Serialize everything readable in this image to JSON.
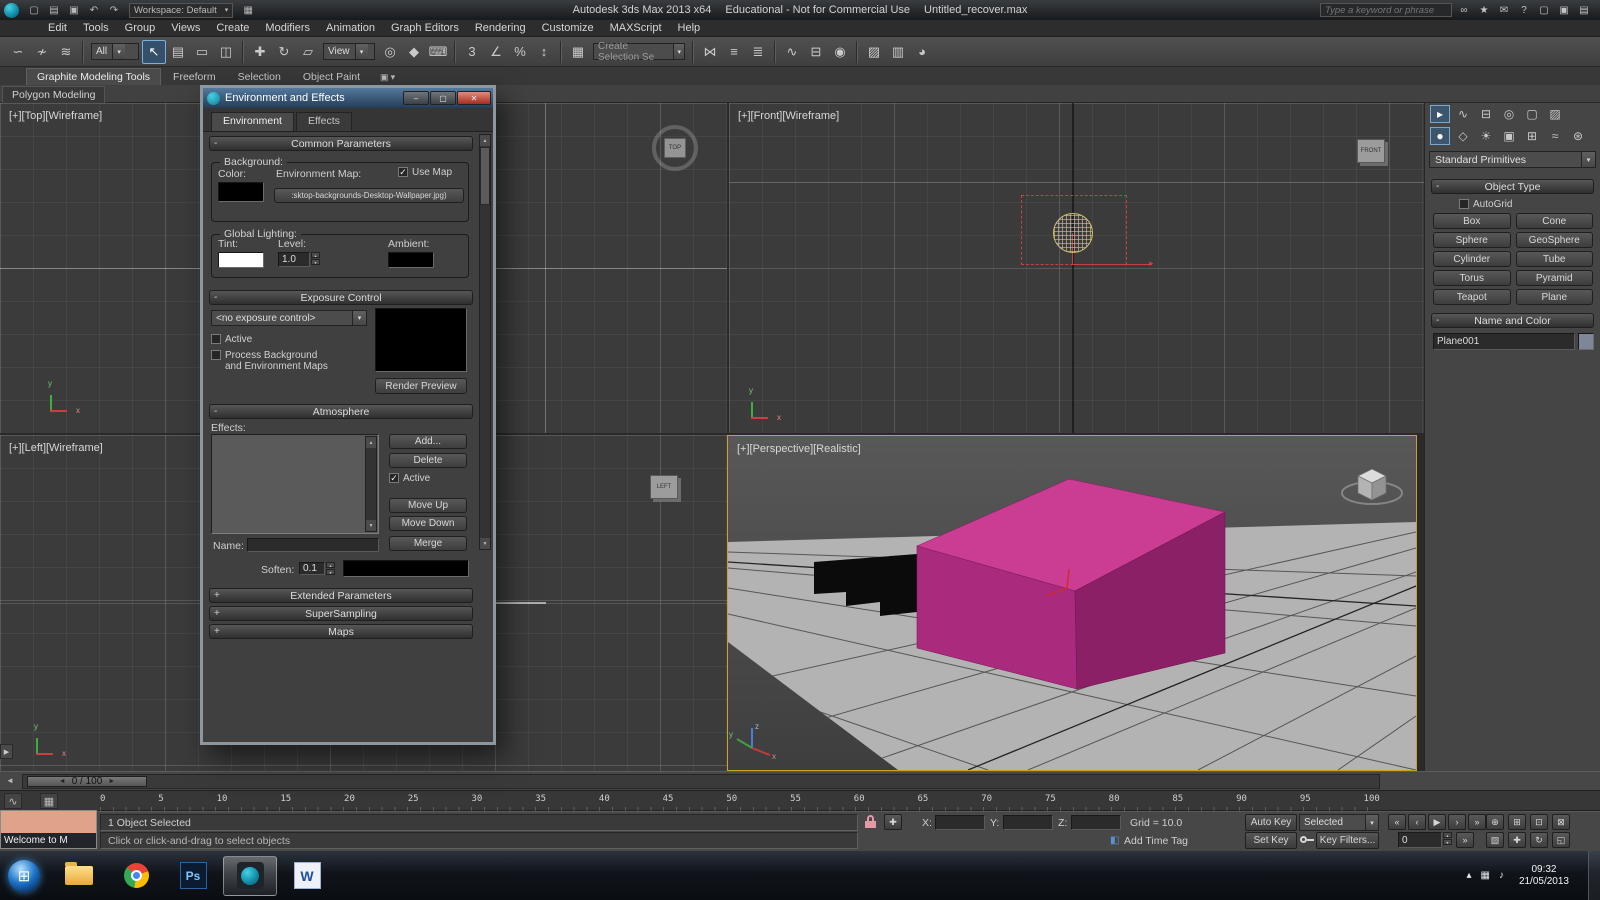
{
  "app": {
    "title_product": "Autodesk 3ds Max  2013 x64",
    "title_license": "Educational - Not for Commercial Use",
    "title_file": "Untitled_recover.max",
    "workspace": "Workspace: Default",
    "search_placeholder": "Type a keyword or phrase"
  },
  "colors": {
    "viewport_bg": "#3b3b3b",
    "active_viewport_border": "#c8a22e",
    "box_top": "#cb3d93",
    "box_front": "#aa2a7e",
    "box_right": "#8c2067",
    "ground": "#b3b3b3",
    "selection_red": "#c84040",
    "env_sphere_yellow": "#dbcb7c",
    "dialog_titlebar": "#54789c"
  },
  "menus": [
    "Edit",
    "Tools",
    "Group",
    "Views",
    "Create",
    "Modifiers",
    "Animation",
    "Graph Editors",
    "Rendering",
    "Customize",
    "MAXScript",
    "Help"
  ],
  "toolbar": {
    "filter": "All",
    "view": "View",
    "selection_set": "Create Selection Se"
  },
  "ribbon": {
    "tabs": [
      "Graphite Modeling Tools",
      "Freeform",
      "Selection",
      "Object Paint"
    ],
    "panel": "Polygon Modeling"
  },
  "viewports": {
    "top_label": "[+][Top][Wireframe]",
    "front_label": "[+][Front][Wireframe]",
    "left_label": "[+][Left][Wireframe]",
    "persp_label": "[+][Perspective][Realistic]",
    "gizmo_top": "TOP",
    "gizmo_front": "FRONT",
    "gizmo_left": "LEFT",
    "axis_x": "x",
    "axis_y": "y",
    "axis_z": "z"
  },
  "dialog": {
    "title": "Environment and Effects",
    "tabs": [
      "Environment",
      "Effects"
    ],
    "common": {
      "header": "Common Parameters",
      "background": "Background:",
      "color": "Color:",
      "environment_map": "Environment Map:",
      "use_map": "Use Map",
      "map_value": ":sktop-backgrounds-Desktop-Wallpaper.jpg)",
      "global_lighting": "Global Lighting:",
      "tint": "Tint:",
      "level": "Level:",
      "level_value": "1.0",
      "ambient": "Ambient:"
    },
    "exposure": {
      "header": "Exposure Control",
      "mode": "<no exposure control>",
      "active": "Active",
      "process_line1": "Process Background",
      "process_line2": "and Environment Maps",
      "render_preview": "Render Preview"
    },
    "atmosphere": {
      "header": "Atmosphere",
      "effects": "Effects:",
      "add": "Add...",
      "delete": "Delete",
      "active": "Active",
      "move_up": "Move Up",
      "move_down": "Move Down",
      "name": "Name:",
      "merge": "Merge"
    },
    "soften": "Soften:",
    "soften_value": "0.1",
    "rollups": [
      "Extended Parameters",
      "SuperSampling",
      "Maps"
    ]
  },
  "command_panel": {
    "category": "Standard Primitives",
    "object_type_header": "Object Type",
    "autogrid": "AutoGrid",
    "buttons": [
      "Box",
      "Cone",
      "Sphere",
      "GeoSphere",
      "Cylinder",
      "Tube",
      "Torus",
      "Pyramid",
      "Teapot",
      "Plane"
    ],
    "name_color_header": "Name and Color",
    "object_name": "Plane001"
  },
  "timeline": {
    "slider": "0 / 100",
    "ticks": [
      "0",
      "5",
      "10",
      "15",
      "20",
      "25",
      "30",
      "35",
      "40",
      "45",
      "50",
      "55",
      "60",
      "65",
      "70",
      "75",
      "80",
      "85",
      "90",
      "95",
      "100"
    ]
  },
  "status": {
    "selected": "1 Object Selected",
    "prompt": "Click or click-and-drag to select objects",
    "x": "X:",
    "y": "Y:",
    "z": "Z:",
    "grid": "Grid = 10.0",
    "add_time_tag": "Add Time Tag",
    "auto_key": "Auto Key",
    "set_key": "Set Key",
    "key_mode": "Selected",
    "key_filters": "Key Filters...",
    "frame": "0"
  },
  "welcome": {
    "title": "Welcome to M"
  },
  "taskbar": {
    "ps": "Ps",
    "word": "W",
    "time": "09:32",
    "date": "21/05/2013"
  },
  "icons": {
    "minus": "-",
    "plus": "+",
    "caret": "▾",
    "check": "✓",
    "new_doc": "▢",
    "open": "▤",
    "save": "▣",
    "undo": "↶",
    "redo": "↷",
    "qat_extra": "▦",
    "binoculars": "∞",
    "star": "★",
    "mail": "✉",
    "help": "?",
    "panel1": "▢",
    "panel2": "▣",
    "panel3": "▤",
    "win_min": "–",
    "win_max": "▢",
    "win_close": "✕",
    "link": "∽",
    "unlink": "≁",
    "bind": "≋",
    "sel_arrow": "↖",
    "sel_name": "▤",
    "sel_rect": "▭",
    "sel_wc": "◫",
    "move": "✚",
    "rotate": "↻",
    "scale": "▱",
    "pivot": "◎",
    "manip": "◆",
    "kbd": "⌨",
    "snap3": "3",
    "snap_angle": "∠",
    "snap_pct": "%",
    "snap_spin": "↕",
    "named_sets": "▦",
    "mirror": "⋈",
    "align": "≡",
    "layers": "≣",
    "curve": "∿",
    "schematic": "⊟",
    "material": "◉",
    "rsetup": "▨",
    "rframe": "▥",
    "render": "◕",
    "tab_create": "▸",
    "tab_modify": "∿",
    "tab_hier": "⊟",
    "tab_motion": "◎",
    "tab_display": "▢",
    "tab_util": "▨",
    "cat_geo": "●",
    "cat_shapes": "◇",
    "cat_lights": "☀",
    "cat_cam": "▣",
    "cat_help": "⊞",
    "cat_space": "≈",
    "cat_sys": "⊛",
    "scroll_up": "▲",
    "scroll_down": "▼",
    "spin_up": "▴",
    "spin_down": "▾",
    "play": "▶",
    "go_start": "«",
    "prev": "‹",
    "next": "›",
    "go_end": "»",
    "zoom": "⊕",
    "zoom_all": "⊞",
    "ext": "⊡",
    "ext_sel": "⊠",
    "region": "▧",
    "pan": "✚",
    "orbit": "↻",
    "maxtog": "◱",
    "left_arrow": "◄",
    "right_arrow": "►",
    "tray1": "▴",
    "tray2": "▦",
    "tray3": "♪",
    "start": "⊞",
    "timetag": "◧",
    "ribbon_cfg": "▣",
    "mini_curve": "∿",
    "trackbar_mode": "▦",
    "edge_arrow": "▶"
  }
}
